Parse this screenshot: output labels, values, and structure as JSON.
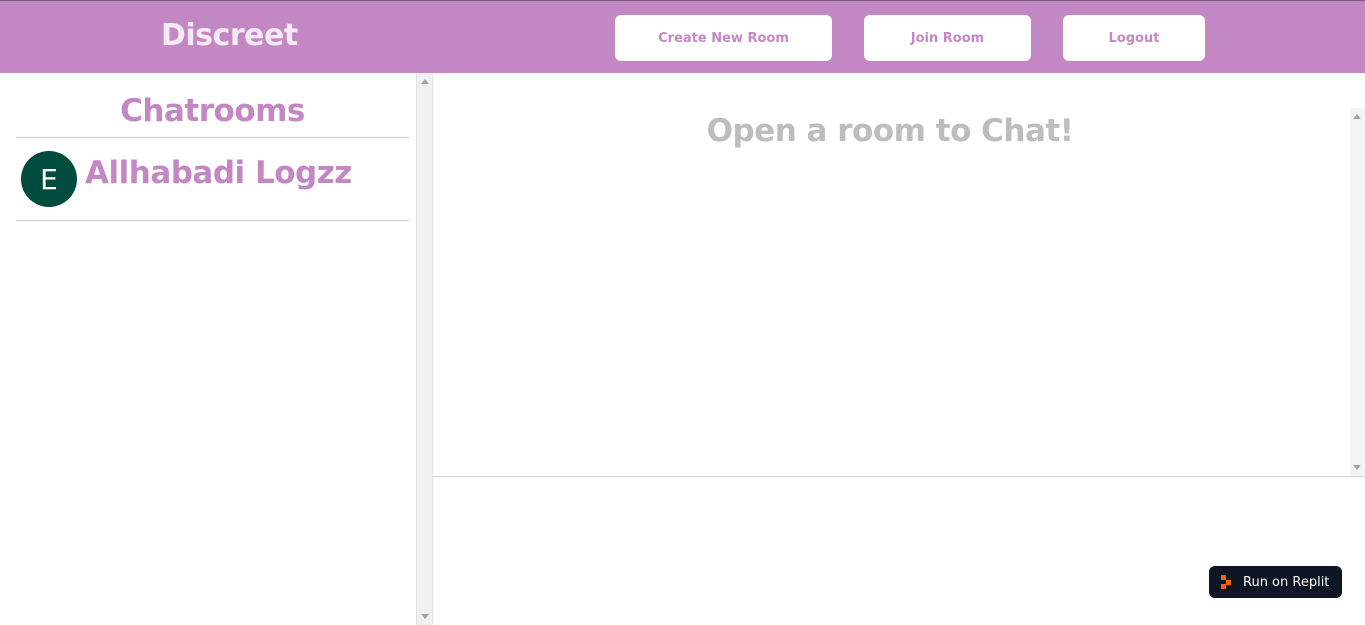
{
  "header": {
    "brand": "Discreet",
    "buttons": {
      "create": "Create New Room",
      "join": "Join Room",
      "logout": "Logout"
    }
  },
  "sidebar": {
    "title": "Chatrooms",
    "rooms": [
      {
        "avatar_letter": "E",
        "name": "Allhabadi Logzz"
      }
    ]
  },
  "chat": {
    "empty_message": "Open a room to Chat!"
  },
  "replit_badge": {
    "label": "Run on Replit"
  },
  "colors": {
    "accent": "#c388c3",
    "avatar_bg": "#004d40",
    "muted_text": "#bdbdbd",
    "badge_bg": "#0e1525",
    "badge_icon": "#f26207"
  }
}
